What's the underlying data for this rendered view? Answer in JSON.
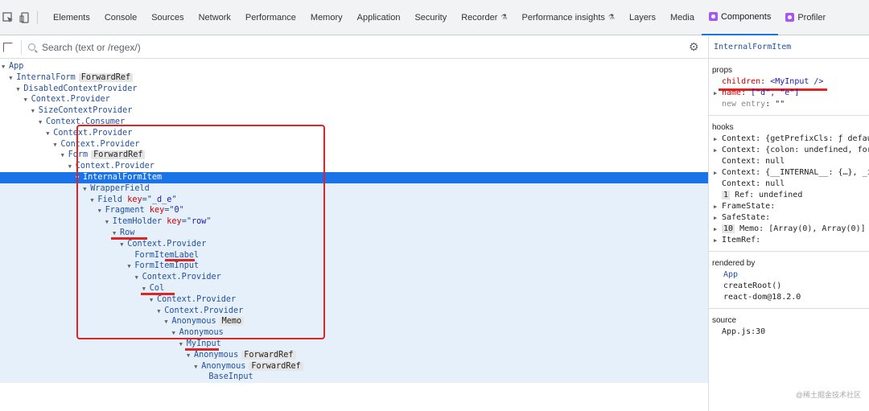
{
  "tabs": [
    {
      "label": "Elements"
    },
    {
      "label": "Console"
    },
    {
      "label": "Sources"
    },
    {
      "label": "Network"
    },
    {
      "label": "Performance"
    },
    {
      "label": "Memory"
    },
    {
      "label": "Application"
    },
    {
      "label": "Security"
    },
    {
      "label": "Recorder",
      "flask": true
    },
    {
      "label": "Performance insights",
      "flask": true
    },
    {
      "label": "Layers"
    },
    {
      "label": "Media"
    },
    {
      "label": "Components",
      "react": true,
      "active": true
    },
    {
      "label": "Profiler",
      "react": true
    }
  ],
  "search": {
    "placeholder": "Search (text or /regex/)"
  },
  "tree": [
    {
      "depth": 0,
      "name": "App"
    },
    {
      "depth": 1,
      "name": "InternalForm",
      "badge": "ForwardRef"
    },
    {
      "depth": 2,
      "name": "DisabledContextProvider"
    },
    {
      "depth": 3,
      "name": "Context.Provider"
    },
    {
      "depth": 4,
      "name": "SizeContextProvider"
    },
    {
      "depth": 5,
      "name": "Context.Consumer"
    },
    {
      "depth": 6,
      "name": "Context.Provider"
    },
    {
      "depth": 7,
      "name": "Context.Provider"
    },
    {
      "depth": 8,
      "name": "Form",
      "badge": "ForwardRef"
    },
    {
      "depth": 9,
      "name": "Context.Provider"
    },
    {
      "depth": 10,
      "name": "InternalFormItem",
      "selected": true
    },
    {
      "depth": 11,
      "name": "WrapperField",
      "sub": true
    },
    {
      "depth": 12,
      "name": "Field",
      "key": "_d_e",
      "sub": true
    },
    {
      "depth": 13,
      "name": "Fragment",
      "key": "0",
      "sub": true
    },
    {
      "depth": 14,
      "name": "ItemHolder",
      "key": "row",
      "sub": true
    },
    {
      "depth": 15,
      "name": "Row",
      "sub": true
    },
    {
      "depth": 16,
      "name": "Context.Provider",
      "sub": true
    },
    {
      "depth": 17,
      "name": "FormItemLabel",
      "sub": true,
      "leaf": true
    },
    {
      "depth": 17,
      "name": "FormItemInput",
      "sub": true
    },
    {
      "depth": 18,
      "name": "Context.Provider",
      "sub": true
    },
    {
      "depth": 19,
      "name": "Col",
      "sub": true
    },
    {
      "depth": 20,
      "name": "Context.Provider",
      "sub": true
    },
    {
      "depth": 21,
      "name": "Context.Provider",
      "sub": true
    },
    {
      "depth": 22,
      "name": "Anonymous",
      "badge": "Memo",
      "sub": true
    },
    {
      "depth": 23,
      "name": "Anonymous",
      "sub": true
    },
    {
      "depth": 24,
      "name": "MyInput",
      "sub": true
    },
    {
      "depth": 25,
      "name": "Anonymous",
      "badge": "ForwardRef",
      "sub": true
    },
    {
      "depth": 26,
      "name": "Anonymous",
      "badge": "ForwardRef",
      "sub": true
    },
    {
      "depth": 27,
      "name": "BaseInput",
      "sub": true,
      "leaf": true
    }
  ],
  "panel": {
    "component": "InternalFormItem",
    "props_header": "props",
    "props": [
      {
        "key": "children",
        "value": "<MyInput />",
        "expandable": false
      },
      {
        "key": "name",
        "value": "[\"d\", \"e\"]",
        "expandable": true
      },
      {
        "key": "new entry",
        "value": "\"\"",
        "expandable": false,
        "dim": true
      }
    ],
    "hooks_header": "hooks",
    "hooks": [
      {
        "text": "Context: {getPrefixCls: ƒ default",
        "expandable": true
      },
      {
        "text": "Context: {colon: undefined, form:",
        "expandable": true
      },
      {
        "text": "Context: null",
        "expandable": false
      },
      {
        "text": "Context: {__INTERNAL__: {…}, _ini",
        "expandable": true
      },
      {
        "text": "Context: null",
        "expandable": false
      },
      {
        "num": "1",
        "text": "Ref: undefined",
        "expandable": false
      },
      {
        "text": "FrameState:",
        "expandable": true
      },
      {
        "text": "SafeState:",
        "expandable": true
      },
      {
        "num": "10",
        "text": "Memo: [Array(0), Array(0)]",
        "expandable": true
      },
      {
        "text": "ItemRef:",
        "expandable": true
      }
    ],
    "rendered_header": "rendered by",
    "rendered": [
      "App",
      "createRoot()",
      "react-dom@18.2.0"
    ],
    "source_header": "source",
    "source": "App.js:30"
  },
  "watermark": "@稀土掘金技术社区"
}
